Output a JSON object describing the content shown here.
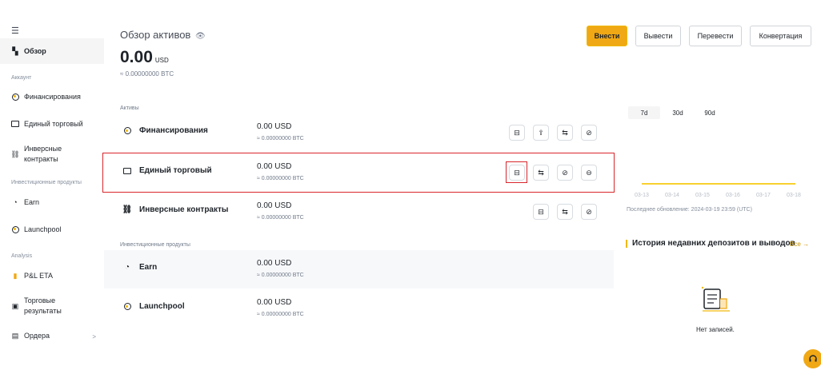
{
  "sidebar": {
    "items": [
      {
        "label": "Обзор",
        "icon": "grid-icon"
      },
      {
        "label": "Финансирования",
        "icon": "coin-icon"
      },
      {
        "label": "Единый торговый",
        "icon": "wallet-icon"
      },
      {
        "label": "Инверсные контракты",
        "icon": "link-icon"
      },
      {
        "label": "Earn",
        "icon": "earn-icon"
      },
      {
        "label": "Launchpool",
        "icon": "launchpool-icon"
      },
      {
        "label": "P&L ETA",
        "icon": "bar-chart-icon"
      },
      {
        "label": "Торговые результаты",
        "icon": "results-icon"
      },
      {
        "label": "Ордера",
        "icon": "orders-icon"
      }
    ],
    "sections": [
      "Аккаунт",
      "Инвестиционные продукты",
      "Analysis"
    ],
    "orders_arrow": ">"
  },
  "header": {
    "title": "Обзор активов",
    "balance": "0.00",
    "balance_unit": "USD",
    "btc_equivalent": "≈ 0.00000000 BTC"
  },
  "actions": {
    "deposit": "Внести",
    "withdraw": "Вывести",
    "transfer": "Перевести",
    "convert": "Конвертация"
  },
  "assets": {
    "section_label": "Активы",
    "invest_label": "Инвестиционные продукты",
    "rows": [
      {
        "name": "Финансирования",
        "amount": "0.00 USD",
        "btc": "≈ 0.00000000 BTC"
      },
      {
        "name": "Единый торговый",
        "amount": "0.00 USD",
        "btc": "≈ 0.00000000 BTC"
      },
      {
        "name": "Инверсные контракты",
        "amount": "0.00 USD",
        "btc": "≈ 0.00000000 BTC"
      },
      {
        "name": "Earn",
        "amount": "0.00 USD",
        "btc": "≈ 0.00000000 BTC"
      },
      {
        "name": "Launchpool",
        "amount": "0.00 USD",
        "btc": "≈ 0.00000000 BTC"
      }
    ]
  },
  "chart": {
    "periods": [
      "7d",
      "30d",
      "90d"
    ],
    "active_period": "7d",
    "ticks": [
      "03-13",
      "03-14",
      "03-15",
      "03-16",
      "03-17",
      "03-18"
    ],
    "updated": "Последнее обновление: 2024-03-19 23:59 (UTC)",
    "line_color": "#f8d12f"
  },
  "history": {
    "title": "История недавних депозитов и выводов",
    "all_link": "Все",
    "empty_text": "Нет записей."
  },
  "colors": {
    "accent": "#f0a815",
    "highlight": "#d9262c"
  }
}
